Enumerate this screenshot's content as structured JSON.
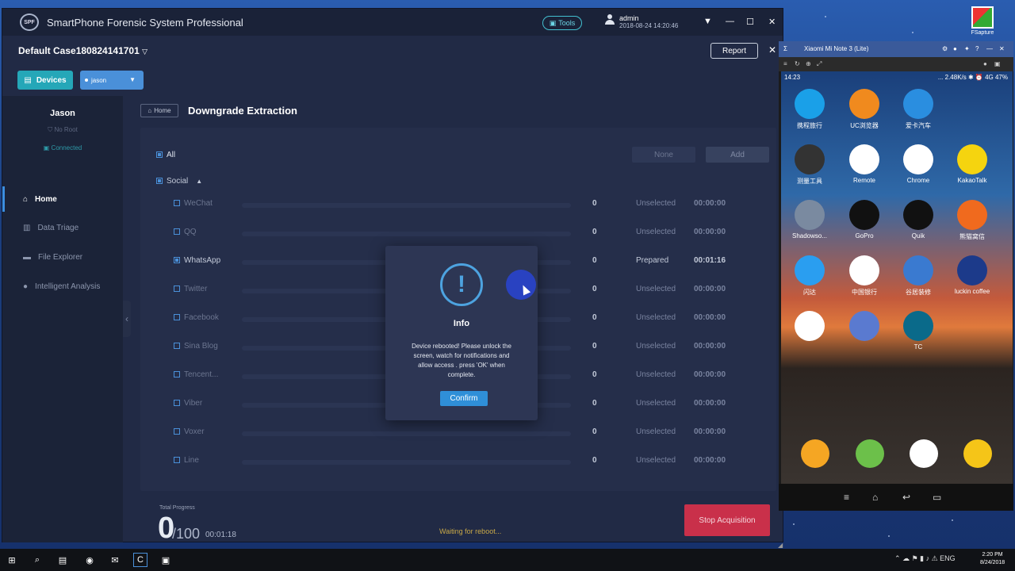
{
  "app": {
    "title": "SmartPhone Forensic System Professional",
    "logo_text": "SPF",
    "tools_label": "Tools",
    "user": {
      "name": "admin",
      "time": "2018-08-24 14:20:46"
    }
  },
  "case": {
    "title": "Default Case180824141701",
    "report_label": "Report"
  },
  "devices": {
    "button_label": "Devices",
    "selected": "jason"
  },
  "sidebar": {
    "device_name": "Jason",
    "root_status": "No Root",
    "connection_status": "Connected",
    "nav": [
      {
        "label": "Home",
        "active": true
      },
      {
        "label": "Data Triage",
        "active": false
      },
      {
        "label": "File Explorer",
        "active": false
      },
      {
        "label": "Intelligent Analysis",
        "active": false
      }
    ]
  },
  "main": {
    "breadcrumb": "Home",
    "page_title": "Downgrade Extraction",
    "all_label": "All",
    "none_label": "None",
    "add_label": "Add",
    "category": "Social",
    "apps": [
      {
        "name": "WeChat",
        "count": "0",
        "status": "Unselected",
        "time": "00:00:00",
        "checked": false
      },
      {
        "name": "QQ",
        "count": "0",
        "status": "Unselected",
        "time": "00:00:00",
        "checked": false
      },
      {
        "name": "WhatsApp",
        "count": "0",
        "status": "Prepared",
        "time": "00:01:16",
        "checked": true
      },
      {
        "name": "Twitter",
        "count": "0",
        "status": "Unselected",
        "time": "00:00:00",
        "checked": false
      },
      {
        "name": "Facebook",
        "count": "0",
        "status": "Unselected",
        "time": "00:00:00",
        "checked": false
      },
      {
        "name": "Sina Blog",
        "count": "0",
        "status": "Unselected",
        "time": "00:00:00",
        "checked": false
      },
      {
        "name": "Tencent...",
        "count": "0",
        "status": "Unselected",
        "time": "00:00:00",
        "checked": false
      },
      {
        "name": "Viber",
        "count": "0",
        "status": "Unselected",
        "time": "00:00:00",
        "checked": false
      },
      {
        "name": "Voxer",
        "count": "0",
        "status": "Unselected",
        "time": "00:00:00",
        "checked": false
      },
      {
        "name": "Line",
        "count": "0",
        "status": "Unselected",
        "time": "00:00:00",
        "checked": false
      }
    ],
    "progress": {
      "label": "Total Progress",
      "value": "0",
      "total": "/100",
      "elapsed": "00:01:18"
    },
    "waiting_text": "Waiting for reboot...",
    "stop_label": "Stop Acquisition"
  },
  "dialog": {
    "title": "Info",
    "message": "Device rebooted! Please unlock the screen, watch for notifications and allow access . press 'OK' when complete.",
    "confirm_label": "Confirm"
  },
  "phone": {
    "window_title": "Xiaomi Mi Note 3 (Lite)",
    "time": "14:23",
    "status_info": "... 2.48K/s ✱ ⏰ 4G 47%",
    "apps": [
      {
        "label": "携程旅行",
        "color": "#1aa0e8"
      },
      {
        "label": "UC浏览器",
        "color": "#f08a1e"
      },
      {
        "label": "爱卡汽车",
        "color": "#2a8ee0"
      },
      {
        "label": "",
        "color": "#transparent"
      },
      {
        "label": "测量工具",
        "color": "#333333"
      },
      {
        "label": "Remote",
        "color": "#ffffff"
      },
      {
        "label": "Chrome",
        "color": "#ffffff"
      },
      {
        "label": "KakaoTalk",
        "color": "#f5d40f"
      },
      {
        "label": "Shadowso...",
        "color": "#7a8aa0"
      },
      {
        "label": "GoPro",
        "color": "#111111"
      },
      {
        "label": "Quik",
        "color": "#111111"
      },
      {
        "label": "熊猫窝信",
        "color": "#f06a1e"
      },
      {
        "label": "闪达",
        "color": "#2a9ef0"
      },
      {
        "label": "中国银行",
        "color": "#ffffff"
      },
      {
        "label": "谷居装修",
        "color": "#3a7ad0"
      },
      {
        "label": "luckin coffee",
        "color": "#1c3a8a"
      },
      {
        "label": "",
        "color": "#ffffff"
      },
      {
        "label": "",
        "color": "#5a7ad0"
      },
      {
        "label": "TC",
        "color": "#0a6a8a"
      }
    ],
    "dock_colors": [
      "#f5a623",
      "#6cc04a",
      "#ffffff",
      "#f5c518"
    ]
  },
  "desktop": {
    "icon_label": "FSapture"
  },
  "taskbar": {
    "time": "2:20 PM",
    "date": "8/24/2018",
    "lang": "ENG"
  }
}
